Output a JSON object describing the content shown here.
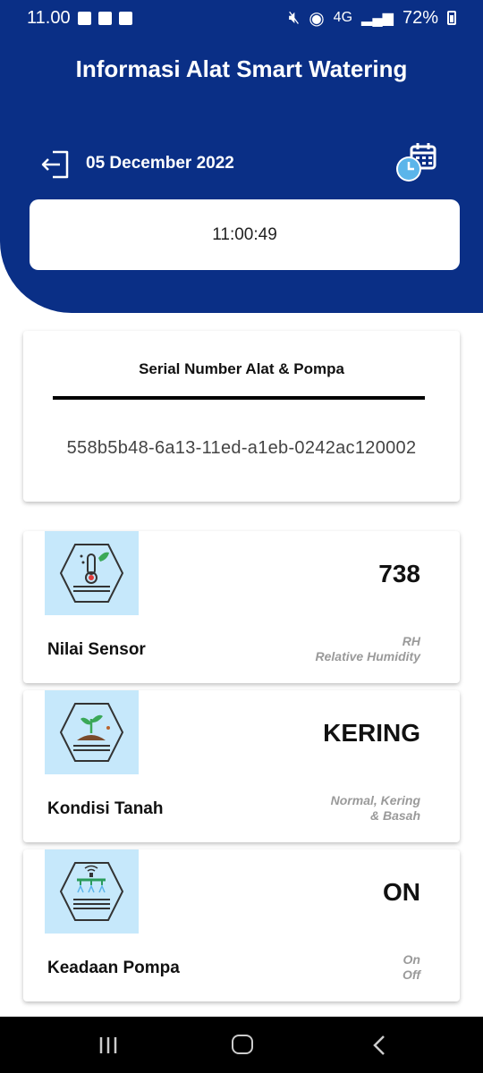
{
  "status_bar": {
    "time": "11.00",
    "network": "4G",
    "battery": "72%"
  },
  "header": {
    "title": "Informasi Alat Smart Watering",
    "date": "05 December 2022",
    "time": "11:00:49"
  },
  "serial": {
    "title": "Serial Number Alat & Pompa",
    "value": "558b5b48-6a13-11ed-a1eb-0242ac120002"
  },
  "cards": [
    {
      "label": "Nilai Sensor",
      "value": "738",
      "unit_line1": "RH",
      "unit_line2": "Relative Humidity",
      "icon": "thermometer-icon"
    },
    {
      "label": "Kondisi Tanah",
      "value": "KERING",
      "unit_line1": "Normal, Kering",
      "unit_line2": "& Basah",
      "icon": "soil-plant-icon"
    },
    {
      "label": "Keadaan Pompa",
      "value": "ON",
      "unit_line1": "On",
      "unit_line2": "Off",
      "icon": "sprinkler-icon"
    }
  ],
  "colors": {
    "primary": "#0a2f86",
    "icon_bg": "#c6e8fb",
    "unit_text": "#9a9a9a"
  }
}
